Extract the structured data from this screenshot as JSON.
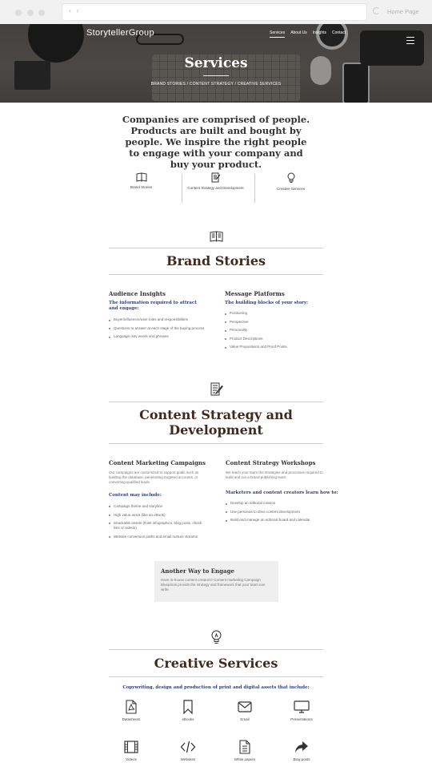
{
  "browser": {
    "nav_arrows": "‹  ›",
    "home_label": "Home Page"
  },
  "header": {
    "logo": "StorytellerGroup",
    "nav": [
      {
        "label": "Services",
        "active": true
      },
      {
        "label": "About Us",
        "active": false
      },
      {
        "label": "Insights",
        "active": false
      },
      {
        "label": "Contact",
        "active": false
      }
    ],
    "title": "Services",
    "breadcrumb": "BRAND STORIES / CONTENT STRATEGY / CREATIVE SERVICES"
  },
  "intro": {
    "text": "Companies are comprised of people. Products are built and bought by people. We inspire the right people to engage with your company and buy your product."
  },
  "service_tiles": [
    {
      "label": "Brand Stories",
      "icon": "book-icon"
    },
    {
      "label": "Content Strategy and Development",
      "icon": "edit-document-icon"
    },
    {
      "label": "Creative Services",
      "icon": "lightbulb-icon"
    }
  ],
  "brand_stories": {
    "title": "Brand Stories",
    "audience": {
      "heading": "Audience Insights",
      "subheading": "The information required to attract and engage:",
      "items": [
        "Buyer/influencer/user roles and responsibilities",
        "Questions to answer at each stage of the buying process",
        "Language, key words and phrases"
      ]
    },
    "messaging": {
      "heading": "Message Platforms",
      "subheading": "The building blocks of your story:",
      "items": [
        "Positioning",
        "Perspective",
        "Personality",
        "Product Descriptions",
        "Value Propositions and Proof Points"
      ]
    }
  },
  "content_strategy": {
    "title_line1": "Content Strategy and",
    "title_line2": "Development",
    "campaigns": {
      "heading": "Content Marketing Campaigns",
      "text": "Our campaigns are customized to support goals such as building the database, penetrating targeted accounts, or converting qualified leads.",
      "subheading": "Content may include:",
      "items": [
        "Campaign theme and storyline",
        "High value asset (like an eBook)",
        "Snackable assets (think infographics, blog posts, check lists or videos)",
        "Website conversion paths and email nurture streams"
      ]
    },
    "workshops": {
      "heading": "Content Strategy Workshops",
      "text": "We teach your team the strategies and processes required to build and run a brand publishing team.",
      "subheading": "Marketers and content creators learn how to:",
      "items": [
        "Develop an editorial mission",
        "Use personas to drive content development",
        "Build and manage an editorial board and calendar"
      ]
    },
    "callout": {
      "title": "Another Way to Engage",
      "text": "Have in-house content creators? Content marketing Campaign Blueprints provide the strategy and framework that your team can write."
    }
  },
  "creative_services": {
    "title": "Creative Services",
    "subheading": "Copywriting, design and production of print and digital assets that include:",
    "assets": [
      {
        "label": "Datasheets",
        "icon": "pdf-file-icon"
      },
      {
        "label": "eBooks",
        "icon": "bookmark-icon"
      },
      {
        "label": "Email",
        "icon": "envelope-icon"
      },
      {
        "label": "Presentations",
        "icon": "monitor-icon"
      },
      {
        "label": "Videos",
        "icon": "film-icon"
      },
      {
        "label": "Websites",
        "icon": "code-icon"
      },
      {
        "label": "White papers",
        "icon": "document-icon"
      },
      {
        "label": "Blog posts",
        "icon": "share-icon"
      }
    ]
  }
}
